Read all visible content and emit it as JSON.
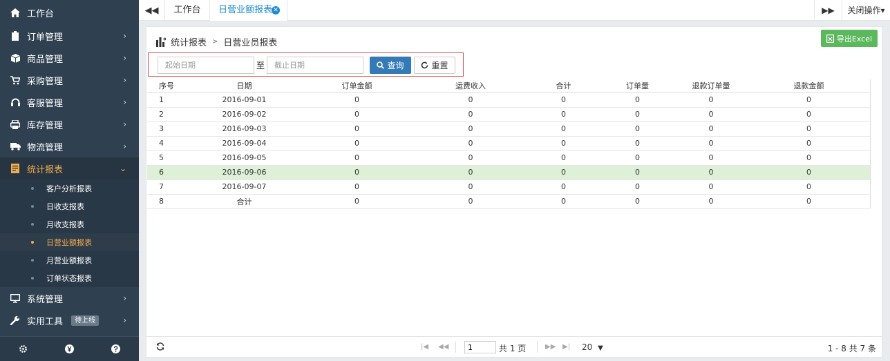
{
  "sidebar": {
    "home_label": "工作台",
    "items": [
      {
        "label": "订单管理"
      },
      {
        "label": "商品管理"
      },
      {
        "label": "采购管理"
      },
      {
        "label": "客服管理"
      },
      {
        "label": "库存管理"
      },
      {
        "label": "物流管理"
      },
      {
        "label": "统计报表"
      }
    ],
    "sub_items": [
      {
        "label": "客户分析报表"
      },
      {
        "label": "日收支报表"
      },
      {
        "label": "月收支报表"
      },
      {
        "label": "日营业额报表"
      },
      {
        "label": "月营业额报表"
      },
      {
        "label": "订单状态报表"
      }
    ],
    "bottom_items": [
      {
        "label": "系统管理"
      },
      {
        "label": "实用工具",
        "badge": "待上线"
      }
    ]
  },
  "tabs": {
    "home": "工作台",
    "current": "日营业额报表",
    "close_ops": "关闭操作"
  },
  "page": {
    "breadcrumb_root": "统计报表",
    "breadcrumb_sep": ">",
    "breadcrumb_current": "日营业员报表",
    "export_label": "导出Excel"
  },
  "filter": {
    "start_placeholder": "起始日期",
    "to_label": "至",
    "end_placeholder": "截止日期",
    "query_label": "查询",
    "reset_label": "重置"
  },
  "table": {
    "headers": [
      "序号",
      "日期",
      "订单金额",
      "运费收入",
      "合计",
      "订单量",
      "退款订单量",
      "退款金额"
    ],
    "rows": [
      [
        "1",
        "2016-09-01",
        "0",
        "0",
        "0",
        "0",
        "0",
        "0"
      ],
      [
        "2",
        "2016-09-02",
        "0",
        "0",
        "0",
        "0",
        "0",
        "0"
      ],
      [
        "3",
        "2016-09-03",
        "0",
        "0",
        "0",
        "0",
        "0",
        "0"
      ],
      [
        "4",
        "2016-09-04",
        "0",
        "0",
        "0",
        "0",
        "0",
        "0"
      ],
      [
        "5",
        "2016-09-05",
        "0",
        "0",
        "0",
        "0",
        "0",
        "0"
      ],
      [
        "6",
        "2016-09-06",
        "0",
        "0",
        "0",
        "0",
        "0",
        "0"
      ],
      [
        "7",
        "2016-09-07",
        "0",
        "0",
        "0",
        "0",
        "0",
        "0"
      ],
      [
        "8",
        "合计",
        "0",
        "0",
        "0",
        "0",
        "0",
        "0"
      ]
    ]
  },
  "pager": {
    "page_value": "1",
    "total_pages": "共 1 页",
    "page_size": "20",
    "info": "1 - 8   共 7 条"
  },
  "colors": {
    "sidebar_bg": "#2f4050",
    "active_accent": "#f0ad4e",
    "primary": "#337ab7",
    "excel": "#5cb85c",
    "tab_active": "#1a8bd6",
    "row_highlight": "#dff0d8",
    "filter_border": "#d9534f"
  }
}
